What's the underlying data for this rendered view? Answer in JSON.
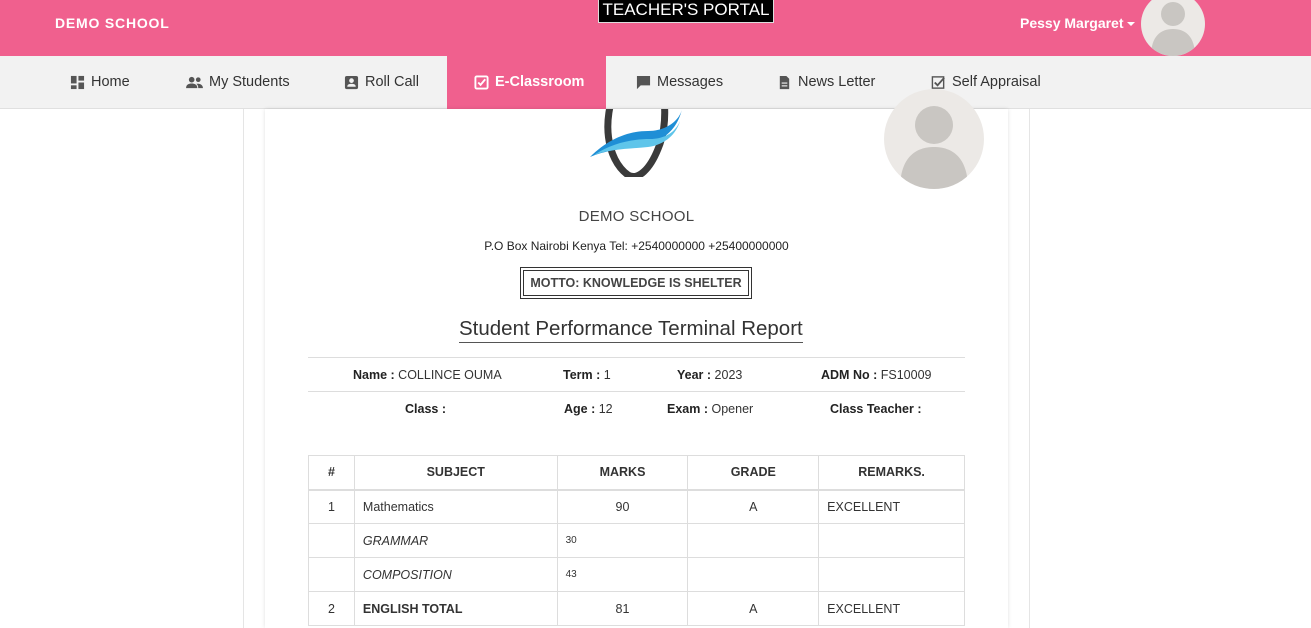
{
  "header": {
    "brand": "DEMO SCHOOL",
    "portal_title": "TEACHER'S PORTAL",
    "user_name": "Pessy Margaret"
  },
  "nav": {
    "items": [
      {
        "label": "Home",
        "icon": "dashboard-icon"
      },
      {
        "label": "My Students",
        "icon": "people-icon"
      },
      {
        "label": "Roll Call",
        "icon": "contact-card-icon"
      },
      {
        "label": "E-Classroom",
        "icon": "checkbox-icon",
        "active": true
      },
      {
        "label": "Messages",
        "icon": "chat-bubble-icon"
      },
      {
        "label": "News Letter",
        "icon": "document-icon"
      },
      {
        "label": "Self Appraisal",
        "icon": "check-square-icon"
      }
    ]
  },
  "report": {
    "school_name": "DEMO SCHOOL",
    "address": "P.O Box Nairobi Kenya Tel: +2540000000 +25400000000",
    "motto": "MOTTO: KNOWLEDGE IS SHELTER",
    "title": "Student Performance Terminal Report",
    "info": {
      "name_label": "Name :",
      "name": "COLLINCE OUMA",
      "term_label": "Term :",
      "term": "1",
      "year_label": "Year :",
      "year": "2023",
      "adm_label": "ADM No :",
      "adm": "FS10009",
      "class_label": "Class :",
      "class": "",
      "age_label": "Age :",
      "age": "12",
      "exam_label": "Exam :",
      "exam": "Opener",
      "teacher_label": "Class Teacher :",
      "teacher": ""
    },
    "table": {
      "headers": [
        "#",
        "SUBJECT",
        "MARKS",
        "GRADE",
        "REMARKS."
      ],
      "rows": [
        {
          "num": "1",
          "subject": "Mathematics",
          "marks": "90",
          "grade": "A",
          "remarks": "EXCELLENT"
        },
        {
          "num": "",
          "subject": "GRAMMAR",
          "marks": "30",
          "grade": "",
          "remarks": ""
        },
        {
          "num": "",
          "subject": "COMPOSITION",
          "marks": "43",
          "grade": "",
          "remarks": ""
        },
        {
          "num": "2",
          "subject": "ENGLISH TOTAL",
          "marks": "81",
          "grade": "A",
          "remarks": "EXCELLENT"
        }
      ]
    }
  },
  "colors": {
    "accent": "#f0608e",
    "nav_bg": "#f2f2f2"
  }
}
